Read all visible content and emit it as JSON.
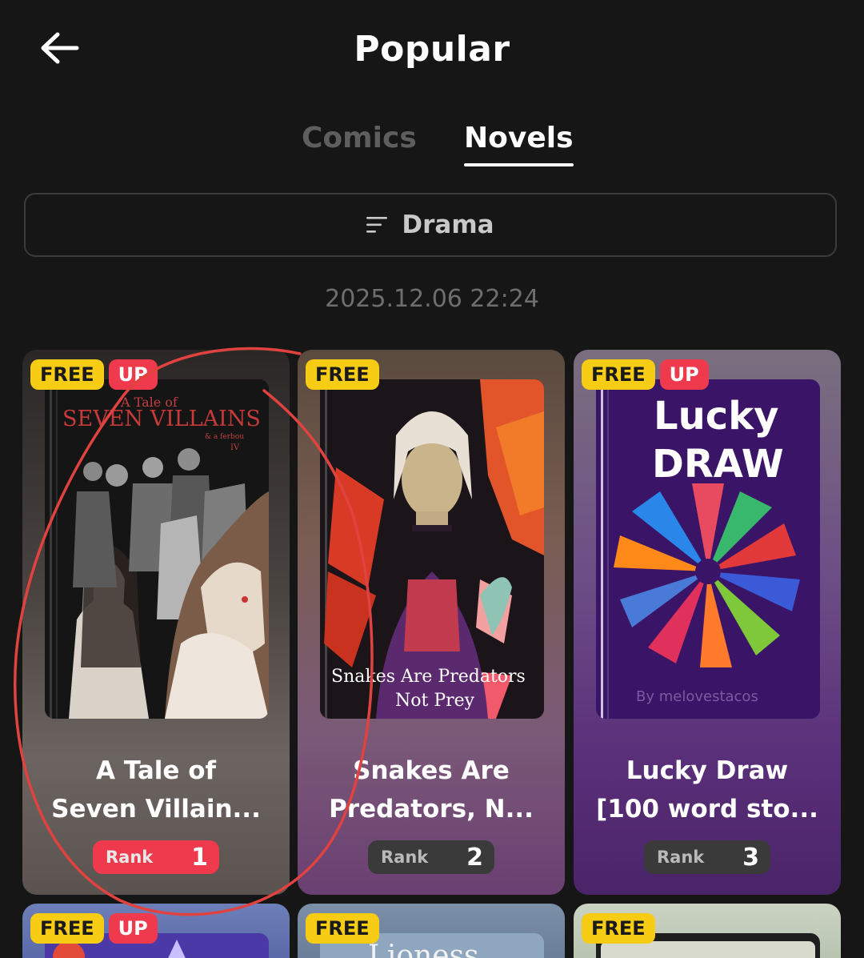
{
  "header": {
    "title": "Popular",
    "back_icon": "arrow-left-icon"
  },
  "tabs": [
    {
      "label": "Comics",
      "active": false
    },
    {
      "label": "Novels",
      "active": true
    }
  ],
  "filter": {
    "label": "Drama",
    "icon": "sort-lines-icon"
  },
  "timestamp": "2025.12.06 22:24",
  "badges": {
    "free": "FREE",
    "up": "UP"
  },
  "rank_label": "Rank",
  "cards": [
    {
      "title_line1": "A Tale of",
      "title_line2": "Seven Villain...",
      "rank": "1",
      "free": true,
      "up": true,
      "cover_text": [
        "A Tale of",
        "SEVEN VILLAINS",
        "& a ferbou",
        "IV"
      ]
    },
    {
      "title_line1": "Snakes Are",
      "title_line2": "Predators, N...",
      "rank": "2",
      "free": true,
      "up": false,
      "cover_text": [
        "Snakes Are Predators",
        "Not Prey"
      ]
    },
    {
      "title_line1": "Lucky Draw",
      "title_line2": "[100 word sto...",
      "rank": "3",
      "free": true,
      "up": true,
      "cover_text": [
        "Lucky",
        "DRAW",
        "By melovestacos"
      ]
    },
    {
      "free": true,
      "up": true
    },
    {
      "free": true,
      "up": false,
      "cover_text": [
        "Lioness"
      ]
    },
    {
      "free": true,
      "up": false
    }
  ],
  "colors": {
    "accent_red": "#ee3a4c",
    "badge_yellow": "#f6cc14",
    "background": "#161616"
  }
}
